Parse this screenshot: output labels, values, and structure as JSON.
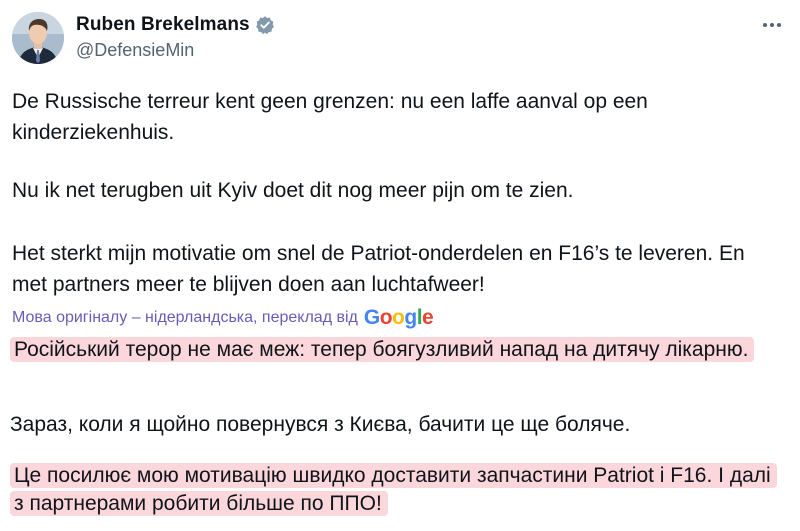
{
  "author": {
    "display_name": "Ruben Brekelmans",
    "handle": "@DefensieMin",
    "verified_icon": "verified-badge-icon",
    "avatar_icon": "profile-photo"
  },
  "post": {
    "paragraph_1": "De Russische terreur kent geen grenzen: nu een laffe aanval op een kinderziekenhuis.",
    "paragraph_2": "Nu ik net terugben uit Kyiv doet dit nog meer pijn om te zien.",
    "paragraph_3": "Het sterkt mijn motivatie om snel de Patriot-onderdelen en F16’s te leveren. En met partners meer te blijven doen aan luchtafweer!"
  },
  "translation": {
    "note": "Мова оригіналу – нідерландська, переклад від",
    "provider": "Google",
    "paragraph_1": "Російський терор не має меж: тепер боягузливий напад на дитячу лікарню.",
    "paragraph_2": "Зараз, коли я щойно повернувся з Києва, бачити це ще боляче.",
    "paragraph_3": "Це посилює мою мотивацію швидко доставити запчастини Patriot і F16. І далі з партнерами робити більше по ППО!"
  },
  "colors": {
    "highlight": "#fbd7dc",
    "translate_note": "#6b5bb8",
    "verified": "#829aab",
    "handle": "#536471"
  },
  "icons": {
    "more": "more-options-icon"
  }
}
